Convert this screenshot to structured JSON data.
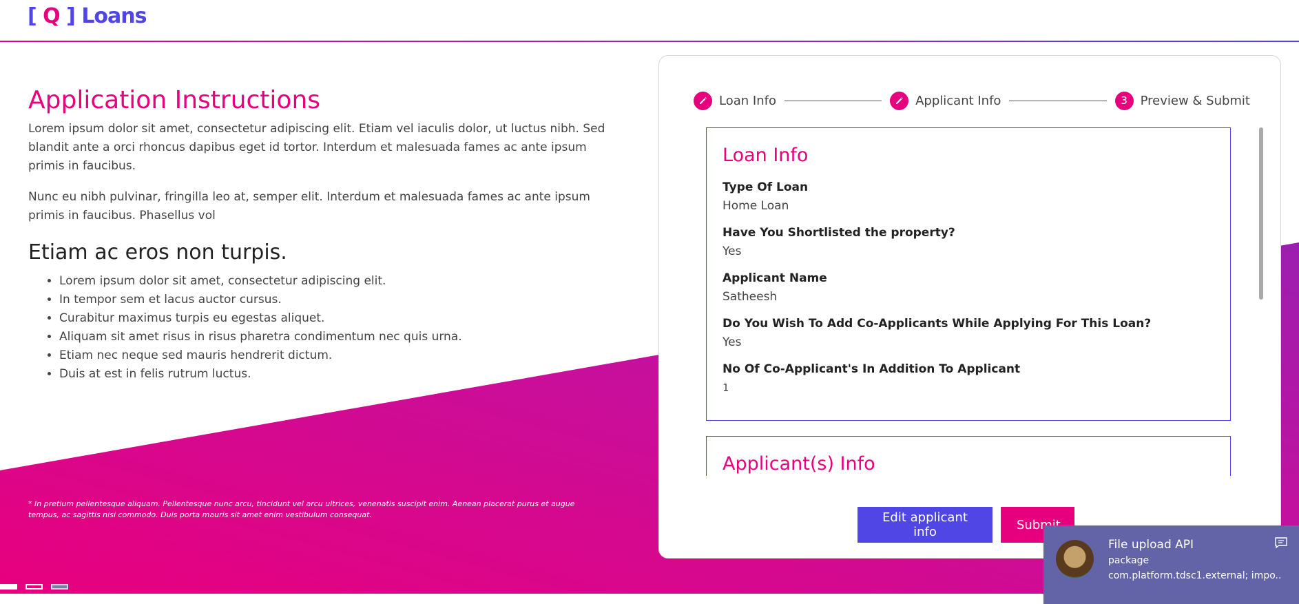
{
  "header": {
    "logo_bracket_left": "[",
    "logo_q": "Q",
    "logo_bracket_right": "]",
    "logo_text": "Loans"
  },
  "instructions": {
    "title": "Application Instructions",
    "paragraphs": [
      "Lorem ipsum dolor sit amet, consectetur adipiscing elit. Etiam vel iaculis dolor, ut luctus nibh. Sed blandit ante a orci rhoncus dapibus eget id tortor. Interdum et malesuada fames ac ante ipsum primis in faucibus.",
      "Nunc eu nibh pulvinar, fringilla leo at, semper elit. Interdum et malesuada fames ac ante ipsum primis in faucibus. Phasellus vol"
    ],
    "subtitle": "Etiam ac eros non turpis.",
    "list": [
      "Lorem ipsum dolor sit amet, consectetur adipiscing elit.",
      "In tempor sem et lacus auctor cursus.",
      "Curabitur maximus turpis eu egestas aliquet.",
      "Aliquam sit amet risus in risus pharetra condimentum nec quis urna.",
      "Etiam nec neque sed mauris hendrerit dictum.",
      "Duis at est in felis rutrum luctus."
    ],
    "footnote": "* In pretium pellentesque aliquam. Pellentesque nunc arcu, tincidunt vel arcu ultrices, venenatis suscipit enim. Aenean placerat purus et augue tempus, ac sagittis nisi commodo. Duis porta mauris sit amet enim vestibulum consequat."
  },
  "stepper": {
    "steps": [
      {
        "label": "Loan Info",
        "icon": "pencil-icon",
        "state": "done"
      },
      {
        "label": "Applicant Info",
        "icon": "pencil-icon",
        "state": "done"
      },
      {
        "label": "Preview & Submit",
        "number": "3",
        "state": "active"
      }
    ]
  },
  "loan_info": {
    "title": "Loan Info",
    "fields": [
      {
        "label": "Type Of Loan",
        "value": "Home Loan"
      },
      {
        "label": "Have You Shortlisted the property?",
        "value": "Yes"
      },
      {
        "label": "Applicant Name",
        "value": "Satheesh"
      },
      {
        "label": "Do You Wish To Add Co-Applicants While Applying For This Loan?",
        "value": "Yes"
      },
      {
        "label": "No Of Co-Applicant's In Addition To Applicant",
        "value": "1"
      }
    ]
  },
  "applicants_info": {
    "title": "Applicant(s) Info"
  },
  "actions": {
    "edit_label": "Edit applicant info",
    "submit_label": "Submit"
  },
  "toast": {
    "title": "File upload API",
    "line1": "package",
    "line2": "com.platform.tdsc1.external; impo...",
    "icon": "chat-icon"
  },
  "colors": {
    "primary": "#4f46e5",
    "accent": "#e6007e",
    "gradient_end": "#9b1fb0",
    "toast_bg": "#6264a7"
  }
}
